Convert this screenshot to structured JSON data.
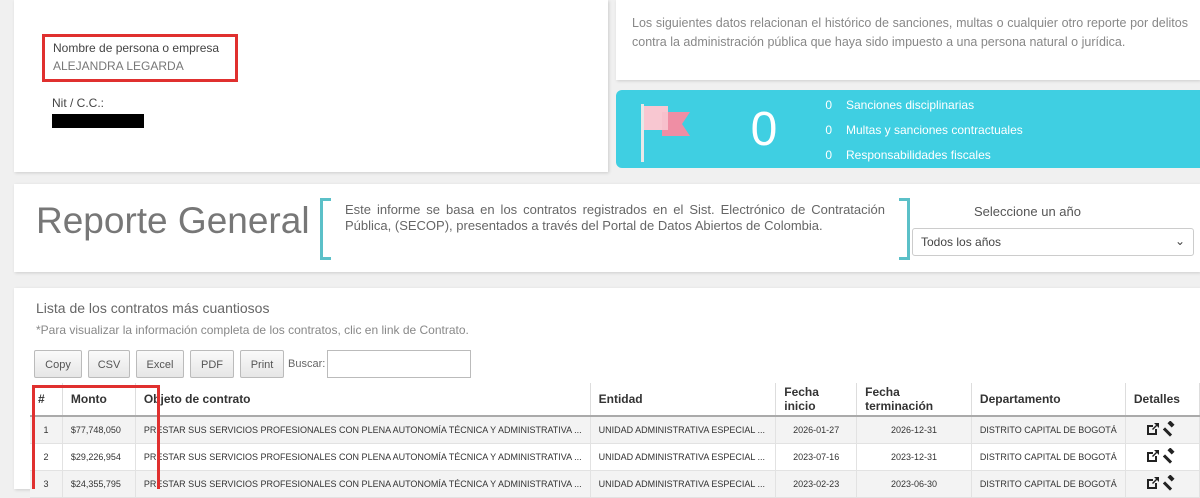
{
  "person": {
    "name_label": "Nombre de persona o empresa",
    "name_value": "ALEJANDRA LEGARDA",
    "nit_label": "Nit / C.C.:"
  },
  "description": "Los siguientes datos relacionan el histórico de sanciones, multas o cualquier otro reporte por delitos contra la administración pública que haya sido impuesto a una persona natural o jurídica.",
  "stats": {
    "total": "0",
    "items": [
      {
        "count": "0",
        "label": "Sanciones disciplinarias"
      },
      {
        "count": "0",
        "label": "Multas y sanciones contractuales"
      },
      {
        "count": "0",
        "label": "Responsabilidades fiscales"
      }
    ]
  },
  "report": {
    "title": "Reporte General",
    "description": "Este informe se basa en los contratos registrados en el Sist. Electrónico de Contratación Pública, (SECOP), presentados a través del Portal de Datos Abiertos de Colombia.",
    "year_label": "Seleccione un año",
    "year_selected": "Todos los años"
  },
  "contracts": {
    "title": "Lista de los contratos más cuantiosos",
    "note": "*Para visualizar la información completa de los contratos, clic en link de Contrato.",
    "buttons": {
      "copy": "Copy",
      "csv": "CSV",
      "excel": "Excel",
      "pdf": "PDF",
      "print": "Print"
    },
    "search_label": "Buscar:",
    "columns": [
      "#",
      "Monto",
      "Objeto de contrato",
      "Entidad",
      "Fecha inicio",
      "Fecha terminación",
      "Departamento",
      "Detalles"
    ],
    "rows": [
      {
        "n": "1",
        "monto": "$77,748,050",
        "objeto": "PRESTAR SUS SERVICIOS PROFESIONALES CON PLENA AUTONOMÍA TÉCNICA Y ADMINISTRATIVA ...",
        "entidad": "UNIDAD ADMINISTRATIVA ESPECIAL ...",
        "inicio": "2026-01-27",
        "fin": "2026-12-31",
        "depto": "DISTRITO CAPITAL DE BOGOTÁ"
      },
      {
        "n": "2",
        "monto": "$29,226,954",
        "objeto": "PRESTAR SUS SERVICIOS PROFESIONALES CON PLENA AUTONOMÍA TÉCNICA Y ADMINISTRATIVA ...",
        "entidad": "UNIDAD ADMINISTRATIVA ESPECIAL ...",
        "inicio": "2023-07-16",
        "fin": "2023-12-31",
        "depto": "DISTRITO CAPITAL DE BOGOTÁ"
      },
      {
        "n": "3",
        "monto": "$24,355,795",
        "objeto": "PRESTAR SUS SERVICIOS PROFESIONALES CON PLENA AUTONOMÍA TÉCNICA Y ADMINISTRATIVA ...",
        "entidad": "UNIDAD ADMINISTRATIVA ESPECIAL ...",
        "inicio": "2023-02-23",
        "fin": "2023-06-30",
        "depto": "DISTRITO CAPITAL DE BOGOTÁ"
      }
    ]
  },
  "colors": {
    "accent_cyan": "#3fcfe2",
    "highlight_red": "#e0302f",
    "bracket_teal": "#5bc0c8",
    "flag_pink": "#f4b8c4"
  },
  "icons": {
    "flag": "flag-icon",
    "external_link": "external-link-icon",
    "gavel": "gavel-icon",
    "chevron": "chevron-down-icon"
  }
}
